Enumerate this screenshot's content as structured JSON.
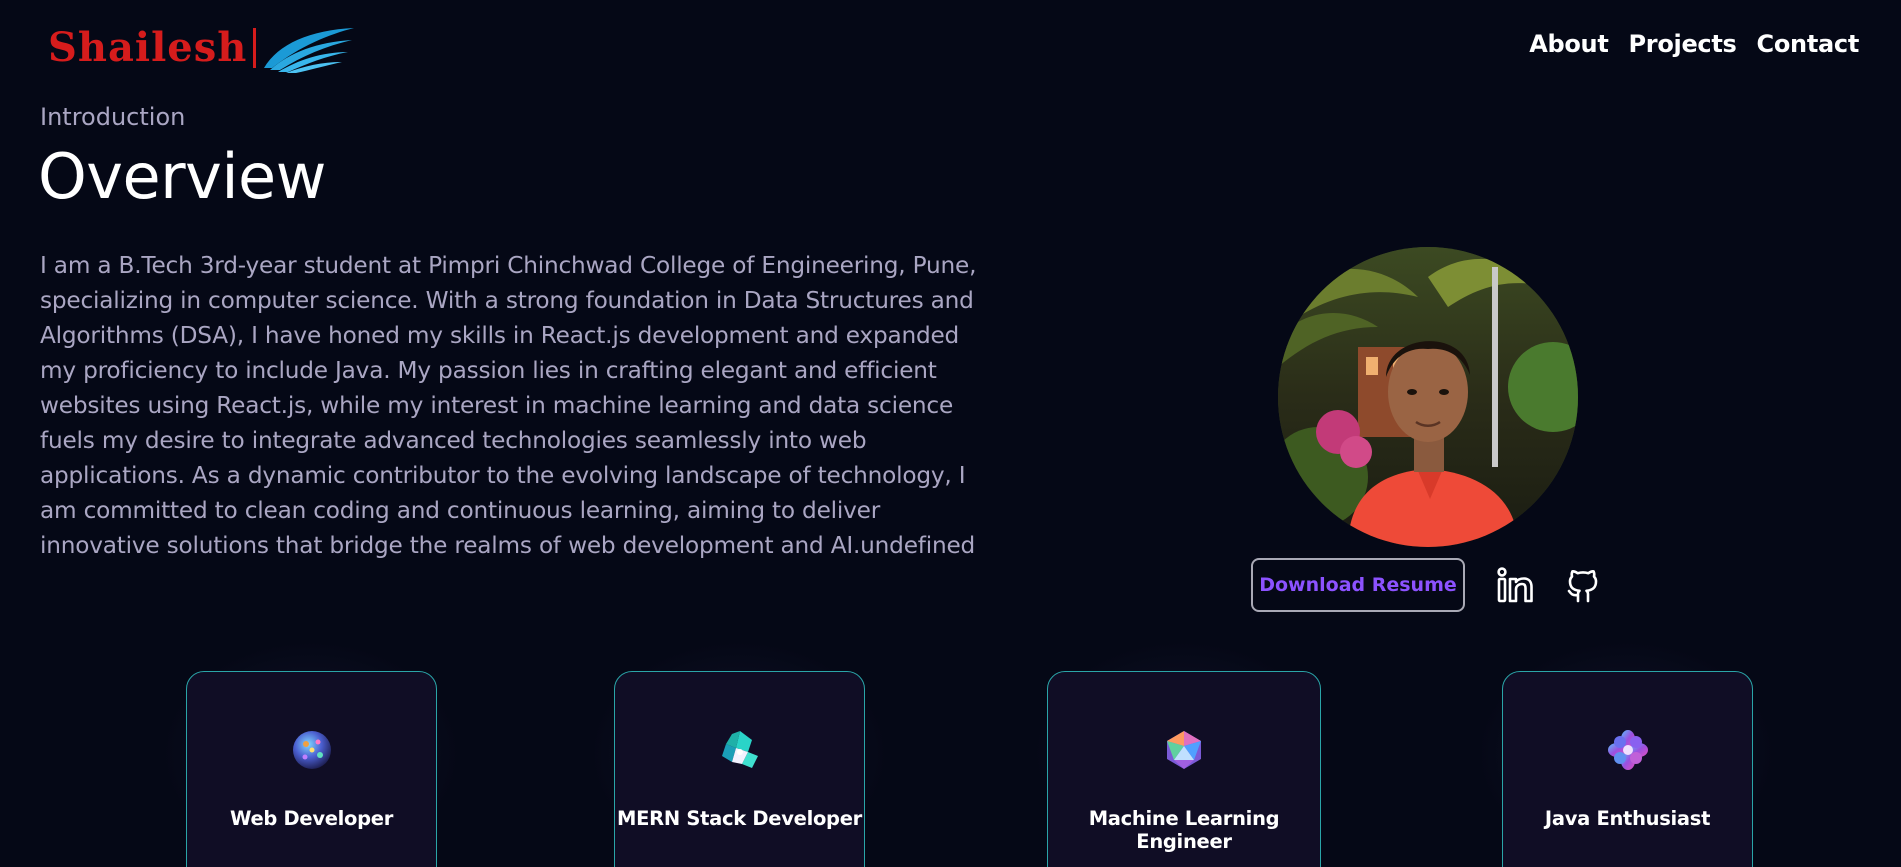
{
  "nav": {
    "logo_text": "Shailesh",
    "links": [
      "About",
      "Projects",
      "Contact"
    ]
  },
  "intro": {
    "subtitle": "Introduction",
    "title": "Overview",
    "bio": "I am a B.Tech 3rd-year student at Pimpri Chinchwad College of Engineering, Pune, specializing in computer science. With a strong foundation in Data Structures and Algorithms (DSA), I have honed my skills in React.js development and expanded my proficiency to include Java. My passion lies in crafting elegant and efficient websites using React.js, while my interest in machine learning and data science fuels my desire to integrate advanced technologies seamlessly into web applications. As a dynamic contributor to the evolving landscape of technology, I am committed to clean coding and continuous learning, aiming to deliver innovative solutions that bridge the realms of web development and AI.undefined"
  },
  "profile": {
    "resume_label": "Download Resume",
    "socials": [
      "linkedin-icon",
      "github-icon"
    ]
  },
  "cards": [
    {
      "title": "Web Developer",
      "icon": "globe-orb-icon"
    },
    {
      "title": "MERN Stack Developer",
      "icon": "crystal-cluster-icon"
    },
    {
      "title": "Machine Learning Engineer",
      "icon": "icosahedron-icon"
    },
    {
      "title": "Java Enthusiast",
      "icon": "flower-gem-icon"
    }
  ],
  "colors": {
    "background": "#050816",
    "secondary_text": "#aaa6c3",
    "accent": "#8c52ff",
    "logo_red": "#d61c1c",
    "card_border": "#2aa5a8"
  }
}
